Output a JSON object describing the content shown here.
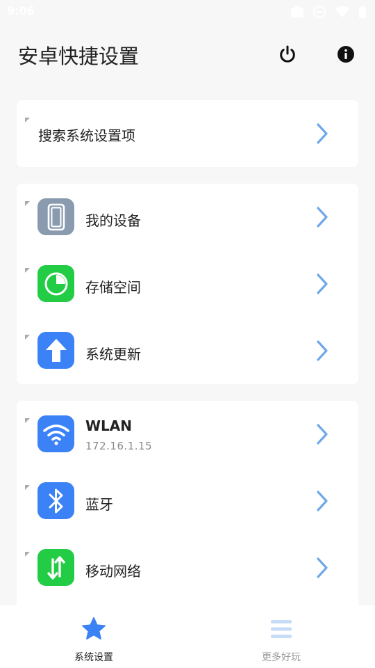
{
  "status_bar": {
    "time": "9:06"
  },
  "header": {
    "title": "安卓快捷设置",
    "power_icon": "power-icon",
    "info_icon": "info-icon"
  },
  "search_card": {
    "label": "搜索系统设置项"
  },
  "device_card": {
    "items": [
      {
        "label": "我的设备",
        "icon": "phone-icon",
        "color": "#8a9bb0"
      },
      {
        "label": "存储空间",
        "icon": "pie-chart-icon",
        "color": "#22cc44"
      },
      {
        "label": "系统更新",
        "icon": "arrow-up-icon",
        "color": "#3b82f6"
      }
    ]
  },
  "network_card": {
    "items": [
      {
        "label": "WLAN",
        "sub": "172.16.1.15",
        "icon": "wifi-icon",
        "color": "#3b82f6"
      },
      {
        "label": "蓝牙",
        "icon": "bluetooth-icon",
        "color": "#3b82f6"
      },
      {
        "label": "移动网络",
        "icon": "mobile-data-icon",
        "color": "#22cc44"
      }
    ]
  },
  "bottom_nav": {
    "tabs": [
      {
        "label": "系统设置",
        "icon": "star-icon",
        "active": true
      },
      {
        "label": "更多好玩",
        "icon": "menu-icon",
        "active": false
      }
    ]
  },
  "colors": {
    "accent": "#3b82f6",
    "chevron": "#6fa8e8",
    "inactive": "#c7ddf7"
  }
}
